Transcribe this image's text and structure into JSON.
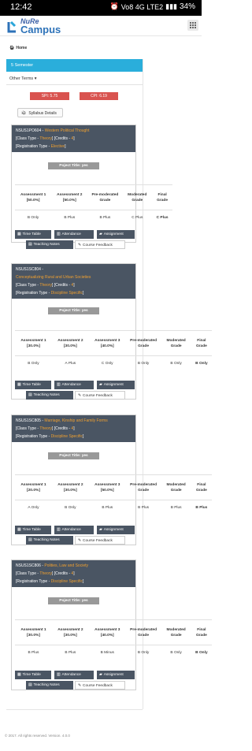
{
  "status": {
    "time": "12:42",
    "battery": "34%",
    "net": "Vo8 4G LTE2"
  },
  "brand": {
    "line1": "NuRe",
    "line2": "Campus"
  },
  "breadcrumb": {
    "home": "Home"
  },
  "semester": {
    "label": "5 Semester"
  },
  "other_terms": {
    "label": "Other Terms"
  },
  "spi": {
    "label": "SPI:",
    "value": "5.75"
  },
  "cpi": {
    "label": "CPI:",
    "value": "6.19"
  },
  "syllabus": {
    "label": "Syllabus Details"
  },
  "courses": [
    {
      "code": "NSUS1PO604 -",
      "name": "Western Political Thought",
      "class_type_label": "[Class Type -",
      "class_type": "Theory",
      "credits_label": "] [Credits -",
      "credits": "4",
      "reg_label": "[Registration Type -",
      "reg_type": "Elective",
      "project_title": "Poject Title: yes",
      "headers": [
        "Assessment 1 [50.0%]",
        "Assessment 2 [50.0%]",
        "Pre-moderated Grade",
        "Moderated Grade",
        "Final Grade"
      ],
      "values": [
        "B Only",
        "B Plus",
        "B Plus",
        "C Plus",
        "C Plus"
      ]
    },
    {
      "code": "NSUS1SC804 -",
      "name": "Conceptualizing Rural and Urban Societies",
      "class_type_label": "[Class Type -",
      "class_type": "Theory",
      "credits_label": "] [Credits -",
      "credits": "4",
      "reg_label": "[Registration Type -",
      "reg_type": "Discipline Specific",
      "project_title": "Poject Title: yes",
      "headers": [
        "Assessment 1 [30.0%]",
        "Assessment 2 [30.0%]",
        "Assessment 3 [40.0%]",
        "Pre-moderated Grade",
        "Moderated Grade",
        "Final Grade"
      ],
      "values": [
        "B Only",
        "A Plus",
        "C Only",
        "B Only",
        "B Only",
        "B Only"
      ]
    },
    {
      "code": "NSUS1SC805 -",
      "name": "Marriage, Kinship and Family Forms",
      "class_type_label": "[Class Type -",
      "class_type": "Theory",
      "credits_label": "] [Credits -",
      "credits": "4",
      "reg_label": "[Registration Type -",
      "reg_type": "Discipline Specific",
      "project_title": "Poject Title: yes",
      "headers": [
        "Assessment 1 [20.0%]",
        "Assessment 2 [30.0%]",
        "Assessment 3 [50.0%]",
        "Pre-moderated Grade",
        "Moderated Grade",
        "Final Grade"
      ],
      "values": [
        "A Only",
        "B Only",
        "B Plus",
        "B Plus",
        "B Plus",
        "B Plus"
      ]
    },
    {
      "code": "NSUS1SC806 -",
      "name": "Polities, Law and Society",
      "class_type_label": "[Class Type -",
      "class_type": "Theory",
      "credits_label": "] [Credits -",
      "credits": "4",
      "reg_label": "[Registration Type -",
      "reg_type": "Discipline Specific",
      "project_title": "Poject Title: yes",
      "headers": [
        "Assessment 1 [30.0%]",
        "Assessment 2 [30.0%]",
        "Assessment 3 [40.0%]",
        "Pre-moderated Grade",
        "Moderated Grade",
        "Final Grade"
      ],
      "values": [
        "B Plus",
        "B Plus",
        "B Minus",
        "B Only",
        "B Only",
        "B Only"
      ]
    }
  ],
  "buttons": {
    "timetable": "Time Table",
    "attendance": "Attendance",
    "assignment": "Assignment",
    "teaching_notes": "Teaching Notes",
    "course_feedback": "Course Feedback"
  },
  "footer": {
    "text": "© 2017. All rights reserved. Version. 4.0.0"
  },
  "colors": {
    "header": "#4a5563",
    "accent": "#2aaedb",
    "danger": "#d9534f",
    "highlight": "#f0a030"
  }
}
